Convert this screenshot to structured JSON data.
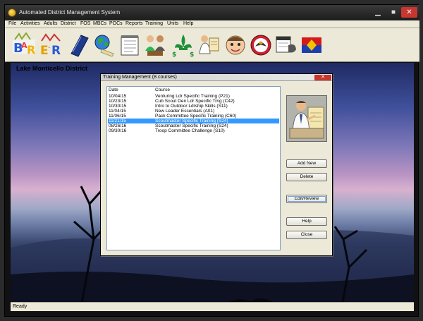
{
  "window": {
    "title": "Automated District Management System"
  },
  "window_controls": {
    "minimize": "▁",
    "maximize": "■",
    "close": "✕"
  },
  "menu": [
    "File",
    "Activities",
    "Adults",
    "District",
    "FOS",
    "MBCs",
    "POCs",
    "Reports",
    "Training",
    "Units",
    "Help"
  ],
  "toolbar": {
    "icons": [
      "bar-logo-icon",
      "er-logo-icon",
      "blue-book-icon",
      "globe-hand-icon",
      "notepad-icon",
      "meeting-people-icon",
      "fleur-de-lis-money-icon",
      "presenter-icon",
      "scout-face-icon",
      "eagle-badge-icon",
      "calendar-phone-icon",
      "district-flag-icon"
    ]
  },
  "district_name": "Lake Monticello District",
  "dialog": {
    "title": "Training Management  (8 courses)",
    "close": "✕",
    "columns": {
      "date": "Date",
      "course": "Course"
    },
    "rows": [
      {
        "date": "10/04/15",
        "course": "Venturing Ldr Specific Training  (P21)"
      },
      {
        "date": "10/23/15",
        "course": "Cub Scout Den Ldr Specific Trng  (C42)"
      },
      {
        "date": "10/30/15",
        "course": "Intro to Outdoor Ldrship Skills  (S11)"
      },
      {
        "date": "11/04/15",
        "course": "New Leader Essentials  (A01)"
      },
      {
        "date": "11/06/15",
        "course": "Pack Committee Specific Training  (C60)"
      },
      {
        "date": "11/21/15",
        "course": "Scoutmaster Specific Training  (S24)"
      },
      {
        "date": "08/26/16",
        "course": "Scoutmaster Specific Training  (S24)"
      },
      {
        "date": "09/30/16",
        "course": "Troop Committee Challenge  (S10)"
      }
    ],
    "selected_index": 5,
    "buttons": {
      "add_new": "Add New",
      "delete": "Delete",
      "edit_review": "Edit/Review",
      "help": "Help",
      "close": "Close"
    }
  },
  "status": "Ready",
  "colors": {
    "selection": "#3399ff",
    "close_button": "#c7372f",
    "face": "#ece9d8"
  }
}
